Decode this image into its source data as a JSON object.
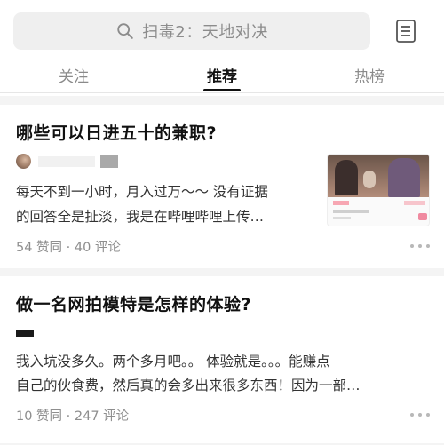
{
  "search": {
    "placeholder_text": "扫毒2：天地对决"
  },
  "icons": {
    "search": "search-icon",
    "menu": "document-list-icon",
    "more": "more-dots-icon"
  },
  "tabs": [
    {
      "label": "关注",
      "active": false
    },
    {
      "label": "推荐",
      "active": true
    },
    {
      "label": "热榜",
      "active": false
    }
  ],
  "feed": [
    {
      "title": "哪些可以日进五十的兼职?",
      "excerpt_line1": "每天不到一小时，月入过万～～ 没有证据",
      "excerpt_line2": "的回答全是扯淡，我是在哔哩哔哩上传…",
      "stats": "54 赞同 · 40 评论",
      "has_thumbnail": true
    },
    {
      "title": "做一名网拍模特是怎样的体验?",
      "excerpt_line1": "我入坑没多久。两个多月吧。。 体验就是。。。能赚点",
      "excerpt_line2": "自己的伙食费，然后真的会多出来很多东西！因为一部…",
      "stats": "10 赞同 · 247 评论",
      "has_thumbnail": false
    }
  ],
  "colors": {
    "accent": "#111111",
    "muted": "#8e8e8e",
    "background": "#f4f4f4"
  }
}
